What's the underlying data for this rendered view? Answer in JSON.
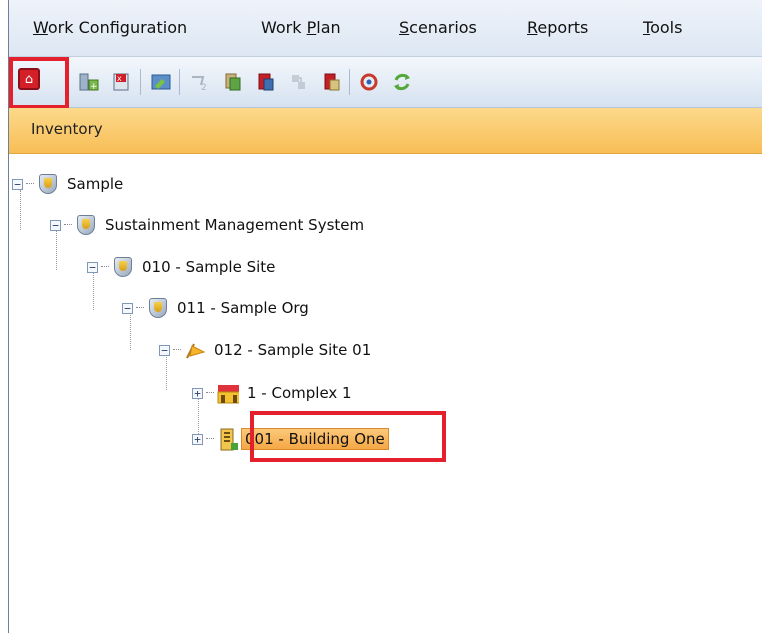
{
  "menu": {
    "items": [
      {
        "underline": "W",
        "rest": "ork Configuration"
      },
      {
        "pre": "Work ",
        "underline": "P",
        "rest": "lan"
      },
      {
        "underline": "S",
        "rest": "cenarios"
      },
      {
        "underline": "R",
        "rest": "eports"
      },
      {
        "underline": "T",
        "rest": "ools"
      }
    ]
  },
  "toolbar": {
    "icons": [
      "home-icon",
      "add-component-icon",
      "delete-component-icon",
      "edit-icon",
      "move-icon",
      "copy-icon",
      "paste-icon",
      "link-icon",
      "unlink-icon",
      "refresh-icon",
      "sync-icon"
    ]
  },
  "panel": {
    "title": "Inventory"
  },
  "tree": {
    "nodes": [
      {
        "label": "Sample",
        "expander": "−"
      },
      {
        "label": "Sustainment Management System",
        "expander": "−"
      },
      {
        "label": "010 - Sample Site",
        "expander": "−"
      },
      {
        "label": "011 - Sample Org",
        "expander": "−"
      },
      {
        "label": "012 - Sample Site 01",
        "expander": "−"
      },
      {
        "label": "1 - Complex 1",
        "expander": "+"
      },
      {
        "label": "001 - Building One",
        "expander": "+"
      }
    ]
  },
  "colors": {
    "highlight": "#e5202d",
    "header": "#f8be56",
    "selected": "#f5a745"
  }
}
